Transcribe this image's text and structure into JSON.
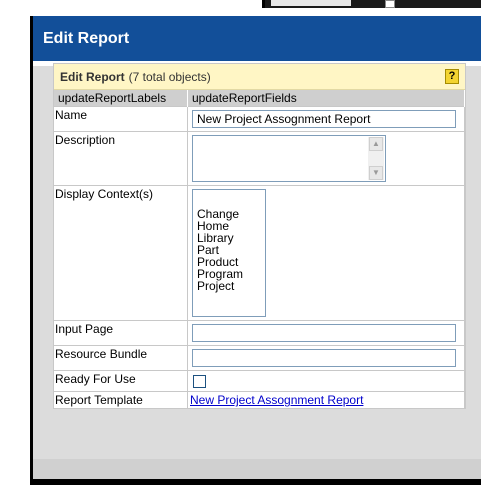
{
  "dialog": {
    "title": "Edit Report"
  },
  "panel": {
    "title": "Edit Report",
    "count": "(7 total objects)",
    "help_label": "?"
  },
  "table": {
    "headers": [
      "updateReportLabels",
      "updateReportFields"
    ],
    "rows": {
      "name": {
        "label": "Name",
        "value": "New Project Assognment Report"
      },
      "description": {
        "label": "Description",
        "value": ""
      },
      "display_context": {
        "label": "Display Context(s)",
        "options": [
          "Change",
          "Home",
          "Library",
          "Part",
          "Product",
          "Program",
          "Project"
        ]
      },
      "input_page": {
        "label": "Input Page",
        "value": ""
      },
      "resource_bundle": {
        "label": "Resource Bundle",
        "value": ""
      },
      "ready_for_use": {
        "label": "Ready For Use",
        "checked": false
      },
      "report_template": {
        "label": "Report Template",
        "link": "New Project Assognment Report"
      }
    }
  },
  "colors": {
    "title_bar": "#124f99",
    "panel_header": "#fff6c5",
    "help_button": "#f3d431",
    "link": "#0000cc"
  }
}
